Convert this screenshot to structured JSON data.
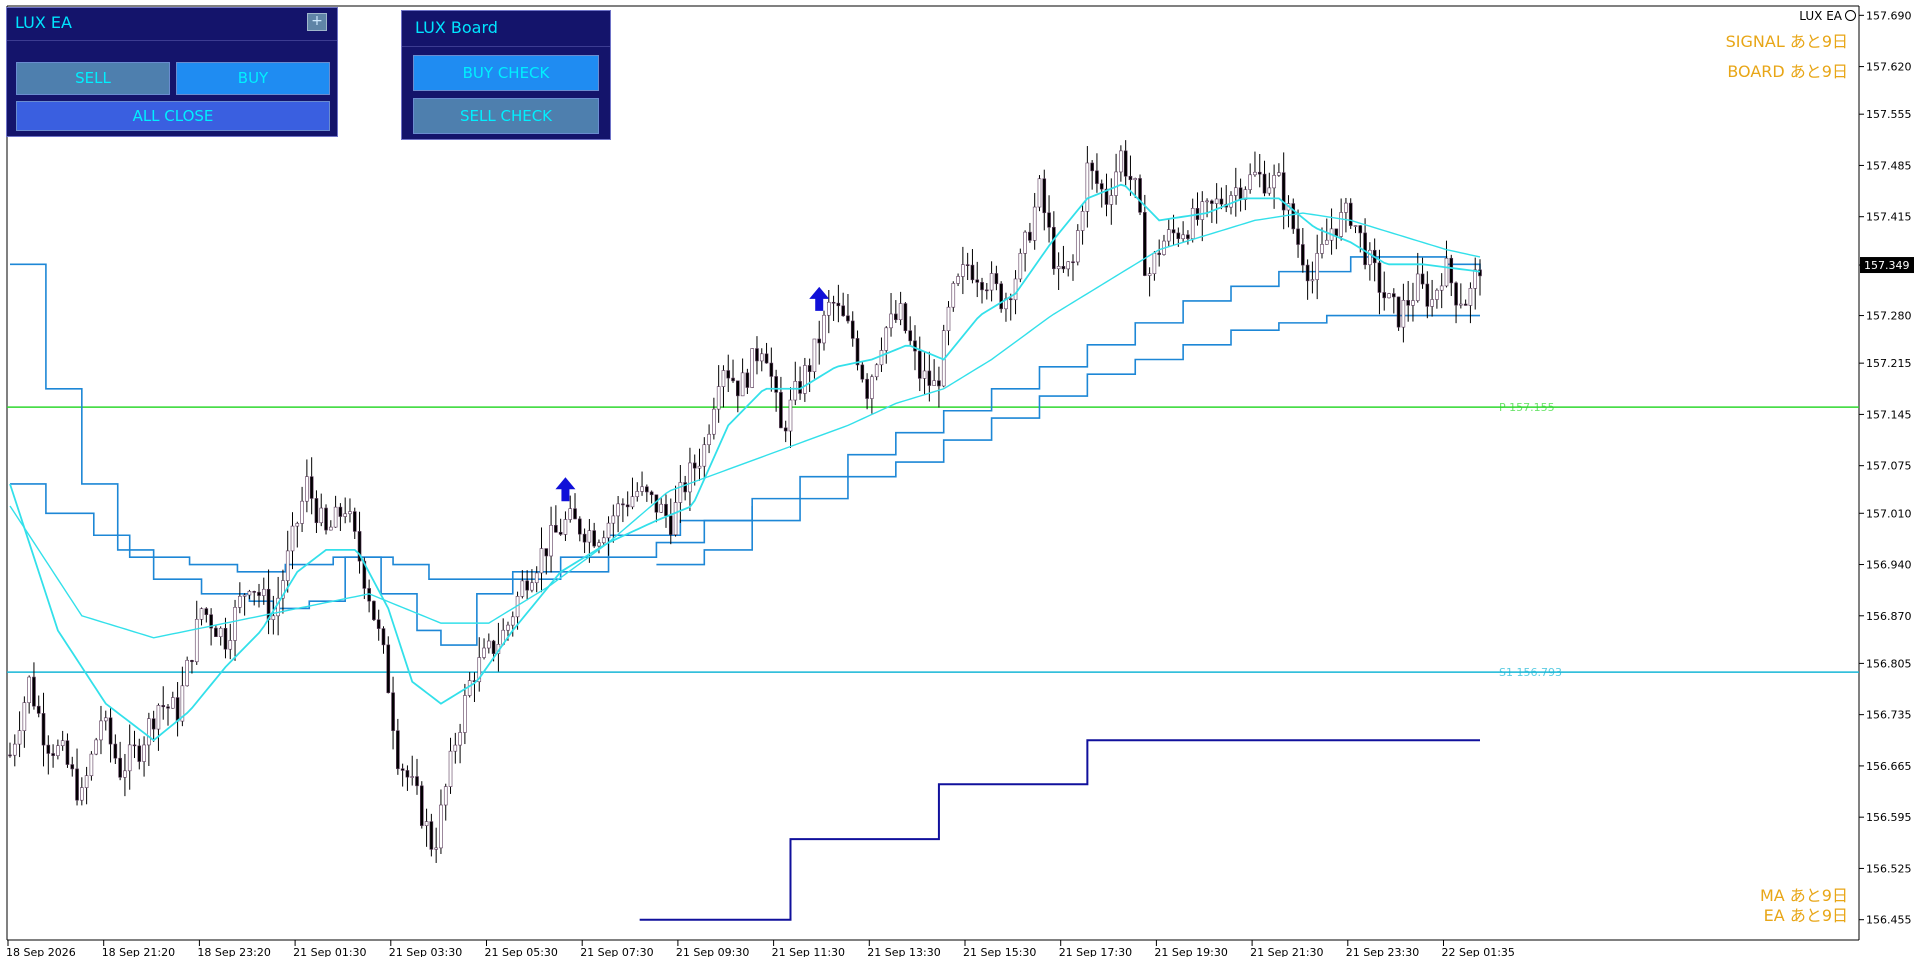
{
  "brand": {
    "label": "LUX EA"
  },
  "panels": {
    "ea": {
      "title": "LUX EA",
      "plus": "+",
      "sell": "SELL",
      "buy": "BUY",
      "all_close": "ALL CLOSE"
    },
    "board": {
      "title": "LUX Board",
      "buy_check": "BUY CHECK",
      "sell_check": "SELL CHECK"
    }
  },
  "status_labels": {
    "signal": "SIGNAL あと9日",
    "board": "BOARD あと9日",
    "ma": "MA あと9日",
    "ea": "EA あと9日"
  },
  "colors": {
    "ma_fast": "#33e0ea",
    "envelope": "#1d87d6",
    "pivot": "#2ed82e",
    "support": "#16b6d6",
    "deep": "#10109c",
    "arrow": "#1010d8",
    "label": "#e8a617"
  },
  "chart_data": {
    "type": "candlestick",
    "symbol_price": 157.349,
    "y_ticks": [
      "157.690",
      "157.620",
      "157.555",
      "157.485",
      "157.415",
      "157.349",
      "157.280",
      "157.215",
      "157.145",
      "157.075",
      "157.010",
      "156.940",
      "156.870",
      "156.805",
      "156.735",
      "156.665",
      "156.595",
      "156.525",
      "156.455"
    ],
    "x_ticks": [
      "18 Sep 2026",
      "18 Sep 21:20",
      "18 Sep 23:20",
      "21 Sep 01:30",
      "21 Sep 03:30",
      "21 Sep 05:30",
      "21 Sep 07:30",
      "21 Sep 09:30",
      "21 Sep 11:30",
      "21 Sep 13:30",
      "21 Sep 15:30",
      "21 Sep 17:30",
      "21 Sep 19:30",
      "21 Sep 21:30",
      "21 Sep 23:30",
      "22 Sep 01:35"
    ],
    "ylim": [
      156.43,
      157.7
    ],
    "n_bars": 300,
    "levels": [
      {
        "name": "P",
        "label": "P 157.155",
        "value": 157.155,
        "color": "#2ed82e"
      },
      {
        "name": "S1",
        "label": "S1 156.793",
        "value": 156.793,
        "color": "#16b6d6"
      }
    ],
    "close_anchors": [
      [
        0,
        156.68
      ],
      [
        8,
        156.78
      ],
      [
        15,
        156.7
      ],
      [
        22,
        156.68
      ],
      [
        30,
        156.62
      ],
      [
        38,
        156.73
      ],
      [
        46,
        156.66
      ],
      [
        54,
        156.69
      ],
      [
        62,
        156.75
      ],
      [
        70,
        156.74
      ],
      [
        80,
        156.88
      ],
      [
        90,
        156.84
      ],
      [
        100,
        156.92
      ],
      [
        110,
        156.87
      ],
      [
        124,
        157.05
      ],
      [
        132,
        156.98
      ],
      [
        140,
        157.02
      ],
      [
        150,
        156.9
      ],
      [
        157,
        156.8
      ],
      [
        162,
        156.68
      ],
      [
        170,
        156.62
      ],
      [
        177,
        156.55
      ],
      [
        186,
        156.7
      ],
      [
        193,
        156.79
      ],
      [
        200,
        156.82
      ],
      [
        207,
        156.85
      ],
      [
        215,
        156.92
      ],
      [
        225,
        156.97
      ],
      [
        233,
        157.0
      ],
      [
        245,
        156.98
      ],
      [
        255,
        157.02
      ],
      [
        262,
        157.04
      ],
      [
        270,
        157.02
      ],
      [
        276,
        157.0
      ],
      [
        282,
        157.05
      ],
      [
        290,
        157.1
      ],
      [
        297,
        157.22
      ],
      [
        305,
        157.18
      ],
      [
        315,
        157.25
      ],
      [
        322,
        157.12
      ],
      [
        329,
        157.18
      ],
      [
        335,
        157.22
      ],
      [
        343,
        157.3
      ],
      [
        352,
        157.25
      ],
      [
        358,
        157.18
      ],
      [
        365,
        157.26
      ],
      [
        372,
        157.28
      ],
      [
        380,
        157.2
      ],
      [
        387,
        157.18
      ],
      [
        393,
        157.3
      ],
      [
        400,
        157.35
      ],
      [
        408,
        157.33
      ],
      [
        415,
        157.3
      ],
      [
        422,
        157.35
      ],
      [
        430,
        157.45
      ],
      [
        438,
        157.33
      ],
      [
        444,
        157.35
      ],
      [
        450,
        157.48
      ],
      [
        458,
        157.44
      ],
      [
        464,
        157.5
      ],
      [
        470,
        157.45
      ],
      [
        475,
        157.33
      ],
      [
        481,
        157.38
      ],
      [
        490,
        157.4
      ],
      [
        500,
        157.42
      ],
      [
        510,
        157.45
      ],
      [
        520,
        157.47
      ],
      [
        530,
        157.46
      ],
      [
        538,
        157.38
      ],
      [
        544,
        157.33
      ],
      [
        552,
        157.4
      ],
      [
        560,
        157.42
      ],
      [
        568,
        157.35
      ],
      [
        575,
        157.3
      ],
      [
        580,
        157.28
      ],
      [
        588,
        157.32
      ],
      [
        594,
        157.3
      ],
      [
        599,
        157.35
      ],
      [
        604,
        157.31
      ],
      [
        609,
        157.3
      ],
      [
        614,
        157.35
      ]
    ],
    "ma_fast_anchors": [
      [
        0,
        157.05
      ],
      [
        20,
        156.85
      ],
      [
        40,
        156.75
      ],
      [
        60,
        156.7
      ],
      [
        75,
        156.74
      ],
      [
        90,
        156.8
      ],
      [
        105,
        156.85
      ],
      [
        120,
        156.93
      ],
      [
        132,
        156.96
      ],
      [
        145,
        156.96
      ],
      [
        158,
        156.88
      ],
      [
        168,
        156.78
      ],
      [
        180,
        156.75
      ],
      [
        195,
        156.78
      ],
      [
        210,
        156.85
      ],
      [
        230,
        156.93
      ],
      [
        250,
        156.97
      ],
      [
        270,
        157.0
      ],
      [
        285,
        157.02
      ],
      [
        300,
        157.13
      ],
      [
        315,
        157.18
      ],
      [
        330,
        157.18
      ],
      [
        345,
        157.21
      ],
      [
        360,
        157.22
      ],
      [
        375,
        157.24
      ],
      [
        390,
        157.22
      ],
      [
        405,
        157.28
      ],
      [
        420,
        157.31
      ],
      [
        435,
        157.38
      ],
      [
        450,
        157.44
      ],
      [
        465,
        157.46
      ],
      [
        480,
        157.41
      ],
      [
        500,
        157.42
      ],
      [
        515,
        157.44
      ],
      [
        530,
        157.44
      ],
      [
        545,
        157.4
      ],
      [
        560,
        157.38
      ],
      [
        575,
        157.35
      ],
      [
        590,
        157.35
      ],
      [
        614,
        157.34
      ]
    ],
    "ma_slow_anchors": [
      [
        0,
        157.02
      ],
      [
        30,
        156.87
      ],
      [
        60,
        156.84
      ],
      [
        90,
        156.86
      ],
      [
        120,
        156.88
      ],
      [
        150,
        156.9
      ],
      [
        180,
        156.86
      ],
      [
        200,
        156.86
      ],
      [
        225,
        156.91
      ],
      [
        250,
        156.97
      ],
      [
        275,
        157.04
      ],
      [
        300,
        157.07
      ],
      [
        325,
        157.1
      ],
      [
        350,
        157.13
      ],
      [
        370,
        157.16
      ],
      [
        390,
        157.18
      ],
      [
        410,
        157.22
      ],
      [
        435,
        157.28
      ],
      [
        460,
        157.33
      ],
      [
        480,
        157.37
      ],
      [
        500,
        157.39
      ],
      [
        520,
        157.41
      ],
      [
        540,
        157.42
      ],
      [
        560,
        157.41
      ],
      [
        580,
        157.39
      ],
      [
        600,
        157.37
      ],
      [
        614,
        157.36
      ]
    ],
    "upper_env_steps": [
      [
        0,
        157.35
      ],
      [
        15,
        157.18
      ],
      [
        30,
        157.05
      ],
      [
        45,
        156.96
      ],
      [
        60,
        156.92
      ],
      [
        80,
        156.9
      ],
      [
        100,
        156.89
      ],
      [
        110,
        156.88
      ],
      [
        125,
        156.89
      ],
      [
        140,
        156.95
      ],
      [
        155,
        156.9
      ],
      [
        170,
        156.85
      ],
      [
        180,
        156.83
      ],
      [
        195,
        156.9
      ],
      [
        210,
        156.93
      ],
      [
        230,
        156.95
      ],
      [
        250,
        156.98
      ],
      [
        280,
        157.0
      ],
      [
        310,
        157.02
      ]
    ],
    "mid_env_steps": [
      [
        0,
        157.05
      ],
      [
        15,
        157.01
      ],
      [
        35,
        156.98
      ],
      [
        50,
        156.95
      ],
      [
        75,
        156.94
      ],
      [
        95,
        156.93
      ],
      [
        115,
        156.94
      ],
      [
        135,
        156.95
      ],
      [
        160,
        156.94
      ],
      [
        175,
        156.92
      ],
      [
        200,
        156.92
      ],
      [
        230,
        156.93
      ],
      [
        250,
        156.95
      ],
      [
        270,
        156.97
      ],
      [
        290,
        157.0
      ],
      [
        310,
        157.03
      ],
      [
        330,
        157.06
      ],
      [
        350,
        157.09
      ],
      [
        370,
        157.12
      ],
      [
        390,
        157.15
      ],
      [
        410,
        157.18
      ],
      [
        430,
        157.21
      ],
      [
        450,
        157.24
      ],
      [
        470,
        157.27
      ],
      [
        490,
        157.3
      ],
      [
        510,
        157.32
      ],
      [
        530,
        157.34
      ],
      [
        560,
        157.36
      ],
      [
        600,
        157.35
      ],
      [
        614,
        157.34
      ]
    ],
    "lower_env_steps": [
      [
        270,
        156.94
      ],
      [
        290,
        156.96
      ],
      [
        310,
        157.0
      ],
      [
        330,
        157.03
      ],
      [
        350,
        157.06
      ],
      [
        370,
        157.08
      ],
      [
        390,
        157.11
      ],
      [
        410,
        157.14
      ],
      [
        430,
        157.17
      ],
      [
        450,
        157.2
      ],
      [
        470,
        157.22
      ],
      [
        490,
        157.24
      ],
      [
        510,
        157.26
      ],
      [
        530,
        157.27
      ],
      [
        550,
        157.28
      ],
      [
        570,
        157.28
      ],
      [
        590,
        157.28
      ],
      [
        614,
        157.28
      ]
    ],
    "deep_steps": [
      [
        263,
        156.455
      ],
      [
        326,
        156.455
      ],
      [
        326,
        156.565
      ],
      [
        388,
        156.565
      ],
      [
        388,
        156.64
      ],
      [
        450,
        156.64
      ],
      [
        450,
        156.7
      ],
      [
        614,
        156.7
      ]
    ],
    "arrows": [
      {
        "bar": 232,
        "value": 157.04
      },
      {
        "bar": 338,
        "value": 157.3
      }
    ]
  }
}
